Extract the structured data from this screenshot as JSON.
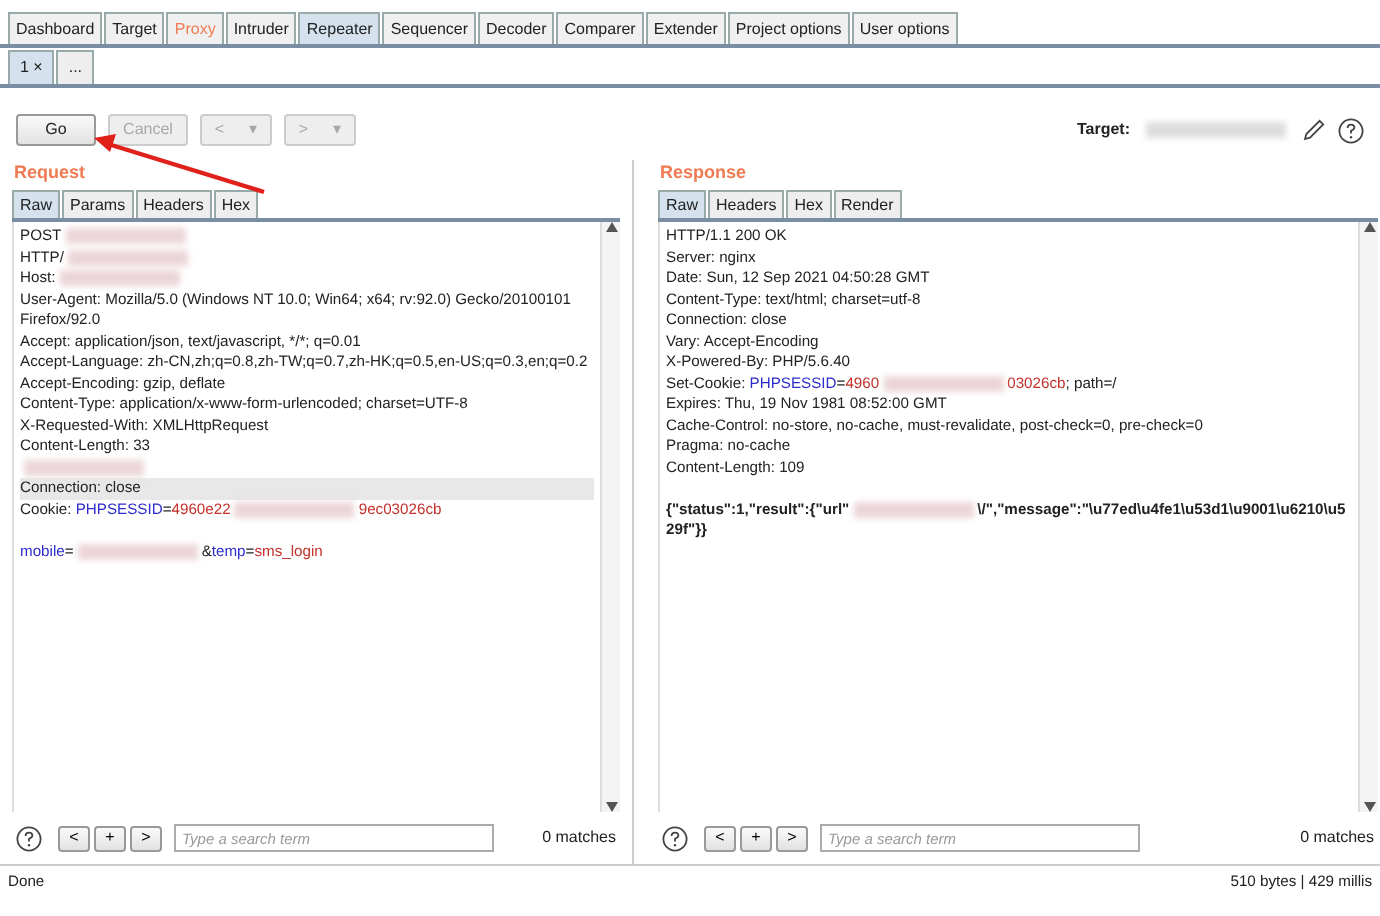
{
  "main_tabs": [
    {
      "label": "Dashboard",
      "selected": false,
      "highlighted": false
    },
    {
      "label": "Target",
      "selected": false,
      "highlighted": false
    },
    {
      "label": "Proxy",
      "selected": false,
      "highlighted": true
    },
    {
      "label": "Intruder",
      "selected": false,
      "highlighted": false
    },
    {
      "label": "Repeater",
      "selected": true,
      "highlighted": false
    },
    {
      "label": "Sequencer",
      "selected": false,
      "highlighted": false
    },
    {
      "label": "Decoder",
      "selected": false,
      "highlighted": false
    },
    {
      "label": "Comparer",
      "selected": false,
      "highlighted": false
    },
    {
      "label": "Extender",
      "selected": false,
      "highlighted": false
    },
    {
      "label": "Project options",
      "selected": false,
      "highlighted": false
    },
    {
      "label": "User options",
      "selected": false,
      "highlighted": false
    }
  ],
  "sub_tabs": [
    {
      "label": "1",
      "close": "×",
      "selected": true
    },
    {
      "label": "...",
      "selected": false
    }
  ],
  "toolbar": {
    "buttons": [
      {
        "label": "Go",
        "disabled": false
      },
      {
        "label": "Cancel",
        "disabled": true
      }
    ],
    "nav": [
      {
        "label": "<",
        "caret": "▾",
        "disabled": true
      },
      {
        "label": ">",
        "caret": "▾",
        "disabled": true
      }
    ],
    "target_label": "Target:"
  },
  "request": {
    "title": "Request",
    "tabs": [
      {
        "label": "Raw",
        "selected": true
      },
      {
        "label": "Params",
        "selected": false
      },
      {
        "label": "Headers",
        "selected": false
      },
      {
        "label": "Hex",
        "selected": false
      }
    ],
    "lines": [
      {
        "highlighted": false,
        "segments": [
          {
            "kind": "plain",
            "text": "POST"
          },
          {
            "kind": "redacted"
          }
        ]
      },
      {
        "highlighted": false,
        "segments": [
          {
            "kind": "plain",
            "text": "HTTP/"
          },
          {
            "kind": "redacted"
          }
        ]
      },
      {
        "highlighted": false,
        "segments": [
          {
            "kind": "plain",
            "text": "Host:"
          },
          {
            "kind": "redacted"
          }
        ]
      },
      {
        "highlighted": false,
        "segments": [
          {
            "kind": "plain",
            "text": "User-Agent: Mozilla/5.0 (Windows NT 10.0; Win64; x64; rv:92.0) Gecko/20100101"
          }
        ]
      },
      {
        "highlighted": false,
        "segments": [
          {
            "kind": "plain",
            "text": "Firefox/92.0"
          }
        ]
      },
      {
        "highlighted": false,
        "segments": [
          {
            "kind": "plain",
            "text": "Accept: application/json, text/javascript, */*; q=0.01"
          }
        ]
      },
      {
        "highlighted": false,
        "segments": [
          {
            "kind": "plain",
            "text": "Accept-Language: zh-CN,zh;q=0.8,zh-TW;q=0.7,zh-HK;q=0.5,en-US;q=0.3,en;q=0.2"
          }
        ]
      },
      {
        "highlighted": false,
        "segments": [
          {
            "kind": "plain",
            "text": "Accept-Encoding: gzip, deflate"
          }
        ]
      },
      {
        "highlighted": false,
        "segments": [
          {
            "kind": "plain",
            "text": "Content-Type: application/x-www-form-urlencoded; charset=UTF-8"
          }
        ]
      },
      {
        "highlighted": false,
        "segments": [
          {
            "kind": "plain",
            "text": "X-Requested-With: XMLHttpRequest"
          }
        ]
      },
      {
        "highlighted": false,
        "segments": [
          {
            "kind": "plain",
            "text": "Content-Length: 33"
          }
        ]
      },
      {
        "highlighted": false,
        "segments": [
          {
            "kind": "redacted"
          }
        ]
      },
      {
        "highlighted": true,
        "segments": [
          {
            "kind": "plain",
            "text": "Connection: close"
          }
        ]
      },
      {
        "highlighted": false,
        "segments": [
          {
            "kind": "plain",
            "text": "Cookie: "
          },
          {
            "kind": "name",
            "text": "PHPSESSID"
          },
          {
            "kind": "plain",
            "text": "="
          },
          {
            "kind": "value",
            "text": "4960e22"
          },
          {
            "kind": "redacted"
          },
          {
            "kind": "value",
            "text": "9ec03026cb"
          }
        ]
      },
      {
        "highlighted": false,
        "gap_before": true,
        "segments": [
          {
            "kind": "name",
            "text": "mobile"
          },
          {
            "kind": "plain",
            "text": "="
          },
          {
            "kind": "redacted"
          },
          {
            "kind": "plain",
            "text": "&"
          },
          {
            "kind": "name",
            "text": "temp"
          },
          {
            "kind": "plain",
            "text": "="
          },
          {
            "kind": "value",
            "text": "sms_login"
          }
        ]
      }
    ],
    "search": {
      "placeholder": "Type a search term",
      "prev": "<",
      "add": "+",
      "next": ">",
      "matches": "0 matches"
    }
  },
  "response": {
    "title": "Response",
    "tabs": [
      {
        "label": "Raw",
        "selected": true
      },
      {
        "label": "Headers",
        "selected": false
      },
      {
        "label": "Hex",
        "selected": false
      },
      {
        "label": "Render",
        "selected": false
      }
    ],
    "lines": [
      {
        "highlighted": false,
        "segments": [
          {
            "kind": "plain",
            "text": "HTTP/1.1 200 OK"
          }
        ]
      },
      {
        "highlighted": false,
        "segments": [
          {
            "kind": "plain",
            "text": "Server: nginx"
          }
        ]
      },
      {
        "highlighted": false,
        "segments": [
          {
            "kind": "plain",
            "text": "Date: Sun, 12 Sep 2021 04:50:28 GMT"
          }
        ]
      },
      {
        "highlighted": false,
        "segments": [
          {
            "kind": "plain",
            "text": "Content-Type: text/html; charset=utf-8"
          }
        ]
      },
      {
        "highlighted": false,
        "segments": [
          {
            "kind": "plain",
            "text": "Connection: close"
          }
        ]
      },
      {
        "highlighted": false,
        "segments": [
          {
            "kind": "plain",
            "text": "Vary: Accept-Encoding"
          }
        ]
      },
      {
        "highlighted": false,
        "segments": [
          {
            "kind": "plain",
            "text": "X-Powered-By: PHP/5.6.40"
          }
        ]
      },
      {
        "highlighted": false,
        "segments": [
          {
            "kind": "plain",
            "text": "Set-Cookie: "
          },
          {
            "kind": "name",
            "text": "PHPSESSID"
          },
          {
            "kind": "plain",
            "text": "="
          },
          {
            "kind": "value",
            "text": "4960"
          },
          {
            "kind": "redacted"
          },
          {
            "kind": "value",
            "text": "03026cb"
          },
          {
            "kind": "plain",
            "text": "; path=/"
          }
        ]
      },
      {
        "highlighted": false,
        "segments": [
          {
            "kind": "plain",
            "text": "Expires: Thu, 19 Nov 1981 08:52:00 GMT"
          }
        ]
      },
      {
        "highlighted": false,
        "segments": [
          {
            "kind": "plain",
            "text": "Cache-Control: no-store, no-cache, must-revalidate, post-check=0, pre-check=0"
          }
        ]
      },
      {
        "highlighted": false,
        "segments": [
          {
            "kind": "plain",
            "text": "Pragma: no-cache"
          }
        ]
      },
      {
        "highlighted": false,
        "segments": [
          {
            "kind": "plain",
            "text": "Content-Length: 109"
          }
        ]
      },
      {
        "highlighted": false,
        "gap_before": true,
        "segments": [
          {
            "kind": "bold",
            "text": "{\"status\":1,\"result\":{\"url\""
          },
          {
            "kind": "redacted"
          },
          {
            "kind": "bold",
            "text": "\\/\",\"message\":\"\\u77ed\\u4fe1\\u53d1\\u9001\\u6210\\u5"
          }
        ]
      },
      {
        "highlighted": false,
        "segments": [
          {
            "kind": "bold",
            "text": "29f\"}}"
          }
        ]
      }
    ],
    "search": {
      "placeholder": "Type a search term",
      "prev": "<",
      "add": "+",
      "next": ">",
      "matches": "0 matches"
    }
  },
  "status_bar": {
    "left": "Done",
    "right": "510 bytes | 429 millis"
  }
}
